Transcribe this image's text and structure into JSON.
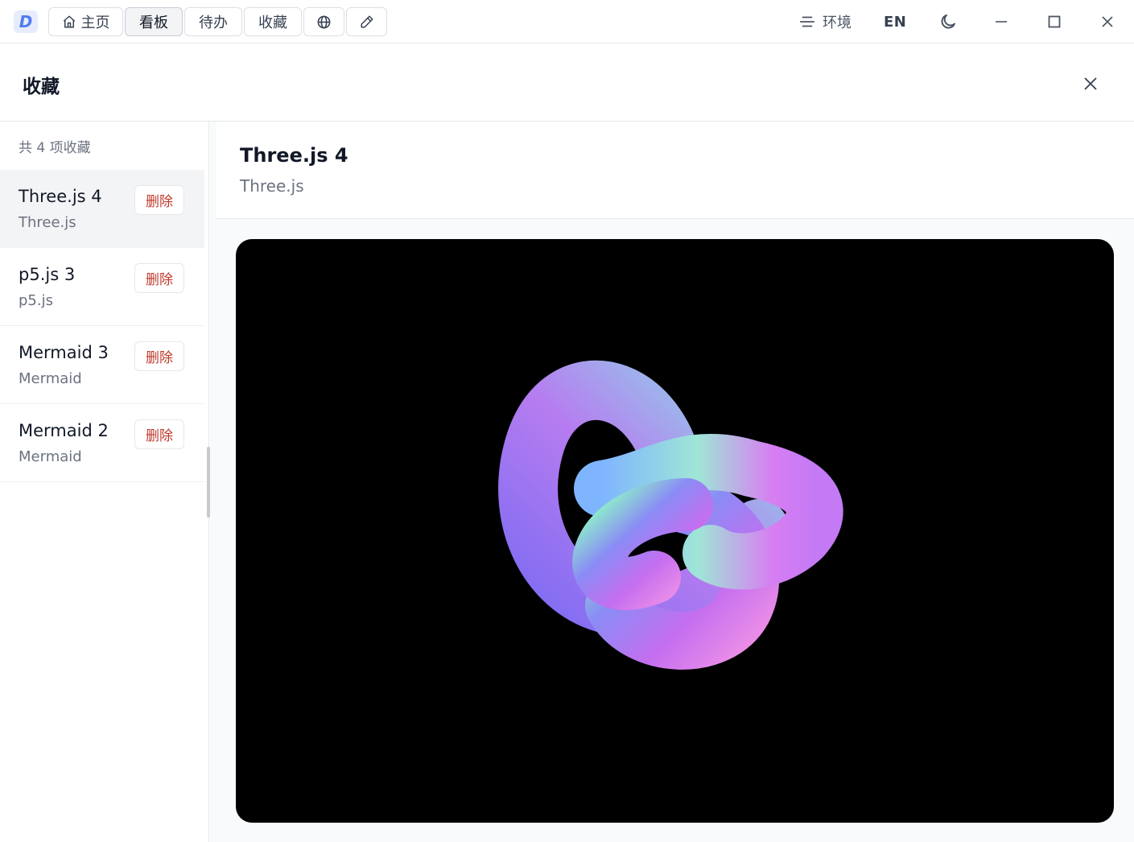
{
  "app": {
    "logo_letter": "D"
  },
  "nav": {
    "home_label": "主页",
    "board_label": "看板",
    "todo_label": "待办",
    "favorites_label": "收藏"
  },
  "toolbar": {
    "env_label": "环境",
    "lang_label": "EN"
  },
  "panel": {
    "title": "收藏"
  },
  "sidebar": {
    "count_text": "共 4 项收藏",
    "items": [
      {
        "name": "Three.js 4",
        "type": "Three.js",
        "delete_label": "删除"
      },
      {
        "name": "p5.js 3",
        "type": "p5.js",
        "delete_label": "删除"
      },
      {
        "name": "Mermaid 3",
        "type": "Mermaid",
        "delete_label": "删除"
      },
      {
        "name": "Mermaid 2",
        "type": "Mermaid",
        "delete_label": "删除"
      }
    ]
  },
  "detail": {
    "title": "Three.js 4",
    "subtitle": "Three.js"
  },
  "colors": {
    "accent": "#4f7cf0",
    "danger": "#c0392b",
    "selected_bg": "#f3f4f6"
  }
}
